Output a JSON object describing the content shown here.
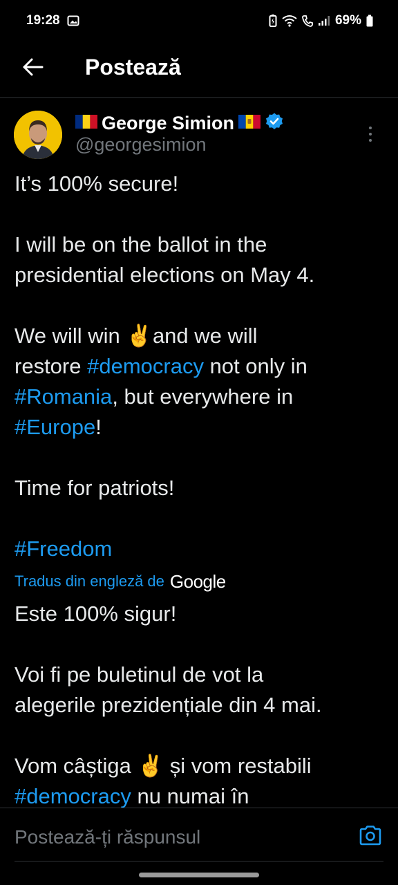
{
  "status_bar": {
    "time": "19:28",
    "battery": "69%"
  },
  "header": {
    "title": "Postează"
  },
  "post": {
    "author_name": "George Simion",
    "handle": "@georgesimion",
    "verified": true,
    "original_lines": [
      "It’s 100% secure!",
      "",
      "I will be on the ballot in the",
      "presidential elections on May 4.",
      "",
      "We will win ✌️and we will",
      "restore #democracy not only in",
      "#Romania, but everywhere in",
      "#Europe!",
      "",
      "Time for patriots!",
      "",
      "#Freedom"
    ],
    "translate_label": "Tradus din engleză de",
    "translate_provider": "Google",
    "translated_lines": [
      "Este 100% sigur!",
      "",
      "Voi fi pe buletinul de vot la",
      "alegerile prezidențiale din 4 mai.",
      "",
      "Vom câștiga ✌️ și vom restabili",
      "#democracy nu numai în"
    ]
  },
  "reply": {
    "placeholder": "Postează-ți răspunsul"
  },
  "colors": {
    "background": "#000000",
    "text": "#e7e9ea",
    "secondary": "#71767b",
    "accent": "#1d9bf0",
    "divider": "#2f3336"
  }
}
